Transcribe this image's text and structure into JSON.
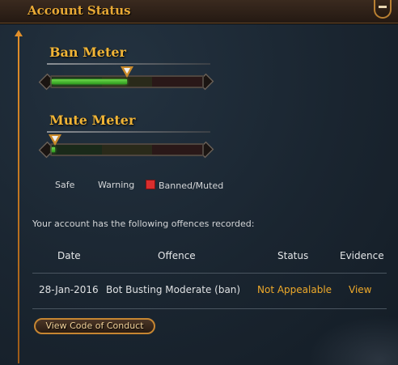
{
  "header": {
    "title": "Account Status"
  },
  "ban_meter": {
    "title": "Ban Meter",
    "level": 0.5
  },
  "mute_meter": {
    "title": "Mute Meter",
    "level": 0.02
  },
  "legend": {
    "safe": "Safe",
    "warning": "Warning",
    "banned": "Banned/Muted"
  },
  "offences": {
    "intro": "Your account has the following offences recorded:",
    "columns": [
      "Date",
      "Offence",
      "Status",
      "Evidence"
    ],
    "rows": [
      {
        "date": "28-Jan-2016",
        "offence": "Bot Busting Moderate (ban)",
        "status": "Not Appealable",
        "evidence": "View"
      }
    ]
  },
  "actions": {
    "code_of_conduct": "View Code of Conduct"
  },
  "colors": {
    "accent": "#efaa2a",
    "meter_green": "#52c232",
    "banned_red": "#d92e2e"
  }
}
